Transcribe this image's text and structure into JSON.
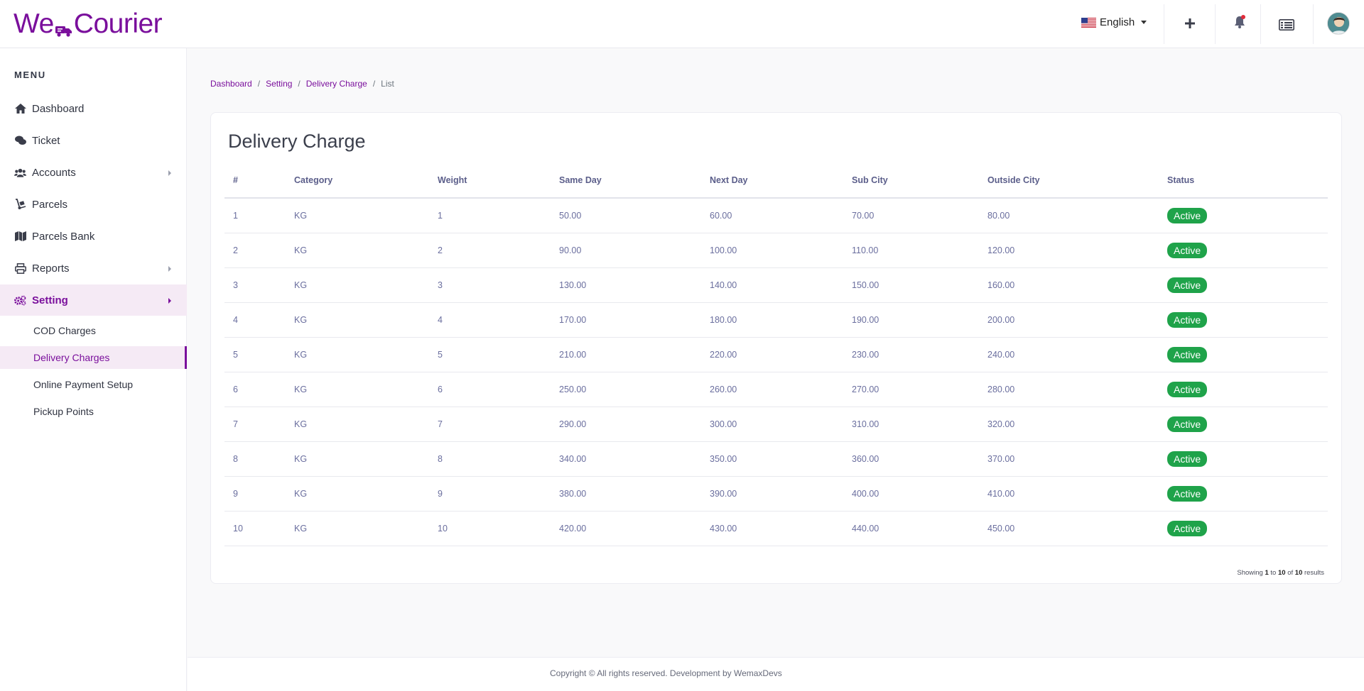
{
  "brand": {
    "logo_left": "We",
    "logo_right": "Courier"
  },
  "header": {
    "language": "English",
    "accent_color": "#7a0f9c"
  },
  "sidebar": {
    "menu_title": "MENU",
    "items": [
      {
        "label": "Dashboard",
        "icon": "home-icon"
      },
      {
        "label": "Ticket",
        "icon": "comments-icon"
      },
      {
        "label": "Accounts",
        "icon": "users-icon",
        "has_children": true
      },
      {
        "label": "Parcels",
        "icon": "dolly-icon"
      },
      {
        "label": "Parcels Bank",
        "icon": "map-icon"
      },
      {
        "label": "Reports",
        "icon": "print-icon",
        "has_children": true
      },
      {
        "label": "Setting",
        "icon": "cogs-icon",
        "has_children": true,
        "active": true
      }
    ],
    "sub_items": [
      {
        "label": "COD Charges"
      },
      {
        "label": "Delivery Charges",
        "active": true
      },
      {
        "label": "Online Payment Setup"
      },
      {
        "label": "Pickup Points"
      }
    ]
  },
  "breadcrumb": {
    "items": [
      "Dashboard",
      "Setting",
      "Delivery Charge"
    ],
    "current": "List"
  },
  "main": {
    "title": "Delivery Charge",
    "columns": [
      "#",
      "Category",
      "Weight",
      "Same Day",
      "Next Day",
      "Sub City",
      "Outside City",
      "Status"
    ],
    "rows": [
      [
        "1",
        "KG",
        "1",
        "50.00",
        "60.00",
        "70.00",
        "80.00",
        "Active"
      ],
      [
        "2",
        "KG",
        "2",
        "90.00",
        "100.00",
        "110.00",
        "120.00",
        "Active"
      ],
      [
        "3",
        "KG",
        "3",
        "130.00",
        "140.00",
        "150.00",
        "160.00",
        "Active"
      ],
      [
        "4",
        "KG",
        "4",
        "170.00",
        "180.00",
        "190.00",
        "200.00",
        "Active"
      ],
      [
        "5",
        "KG",
        "5",
        "210.00",
        "220.00",
        "230.00",
        "240.00",
        "Active"
      ],
      [
        "6",
        "KG",
        "6",
        "250.00",
        "260.00",
        "270.00",
        "280.00",
        "Active"
      ],
      [
        "7",
        "KG",
        "7",
        "290.00",
        "300.00",
        "310.00",
        "320.00",
        "Active"
      ],
      [
        "8",
        "KG",
        "8",
        "340.00",
        "350.00",
        "360.00",
        "370.00",
        "Active"
      ],
      [
        "9",
        "KG",
        "9",
        "380.00",
        "390.00",
        "400.00",
        "410.00",
        "Active"
      ],
      [
        "10",
        "KG",
        "10",
        "420.00",
        "430.00",
        "440.00",
        "450.00",
        "Active"
      ]
    ],
    "results": {
      "prefix": "Showing",
      "from": "1",
      "to_word": "to",
      "to": "10",
      "of_word": "of",
      "total": "10",
      "suffix": "results"
    }
  },
  "footer": {
    "text": "Copyright © All rights reserved. Development by WemaxDevs"
  },
  "colors": {
    "status_active": "#1fa34a"
  }
}
